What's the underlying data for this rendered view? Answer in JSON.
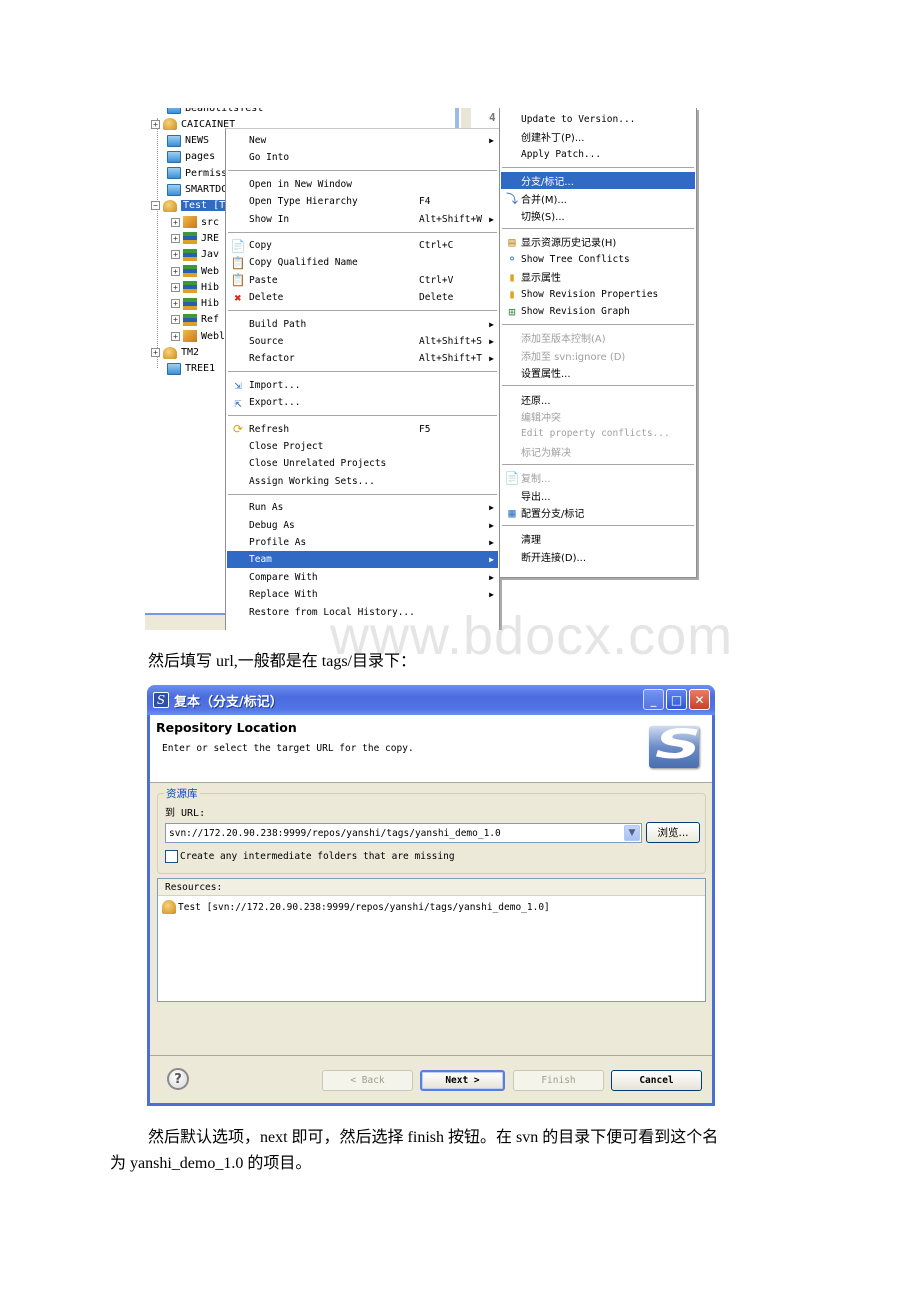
{
  "screenshot1": {
    "tree": {
      "items": [
        {
          "label": "BeanUtilsTest",
          "type": "folder",
          "expander": ""
        },
        {
          "label": "CAICAINET",
          "type": "project",
          "expander": "+"
        },
        {
          "label": "NEWS",
          "type": "folder",
          "expander": ""
        },
        {
          "label": "pages",
          "type": "folder",
          "expander": ""
        },
        {
          "label": "Permiss",
          "type": "folder",
          "expander": ""
        },
        {
          "label": "SMARTDC",
          "type": "folder",
          "expander": ""
        },
        {
          "label": "Test [T",
          "type": "project",
          "expander": "−",
          "selected": true
        },
        {
          "label": "src",
          "type": "pkg",
          "expander": "+"
        },
        {
          "label": "JRE",
          "type": "lib",
          "expander": "+"
        },
        {
          "label": "Jav",
          "type": "lib",
          "expander": "+"
        },
        {
          "label": "Web",
          "type": "lib",
          "expander": "+"
        },
        {
          "label": "Hib",
          "type": "lib",
          "expander": "+"
        },
        {
          "label": "Hib",
          "type": "lib",
          "expander": "+"
        },
        {
          "label": "Ref",
          "type": "lib",
          "expander": "+"
        },
        {
          "label": "Webl",
          "type": "pkg",
          "expander": "+"
        },
        {
          "label": "TM2",
          "type": "project",
          "expander": "+"
        },
        {
          "label": "TREE1",
          "type": "folder",
          "expander": ""
        }
      ]
    },
    "editor_tab_number": "4",
    "context_menu": {
      "items": [
        {
          "label": "New",
          "accel": "",
          "submenu": true,
          "icon": ""
        },
        {
          "label": "Go Into",
          "accel": "",
          "submenu": false,
          "icon": ""
        },
        {
          "separator": true
        },
        {
          "label": "Open in New Window",
          "accel": "",
          "submenu": false,
          "icon": ""
        },
        {
          "label": "Open Type Hierarchy",
          "accel": "F4",
          "submenu": false,
          "icon": ""
        },
        {
          "label": "Show In",
          "accel": "Alt+Shift+W",
          "submenu": true,
          "icon": ""
        },
        {
          "separator": true
        },
        {
          "label": "Copy",
          "accel": "Ctrl+C",
          "submenu": false,
          "icon": "copy-icon"
        },
        {
          "label": "Copy Qualified Name",
          "accel": "",
          "submenu": false,
          "icon": "copy-qualified-icon"
        },
        {
          "label": "Paste",
          "accel": "Ctrl+V",
          "submenu": false,
          "icon": "paste-icon"
        },
        {
          "label": "Delete",
          "accel": "Delete",
          "submenu": false,
          "icon": "delete-icon"
        },
        {
          "separator": true
        },
        {
          "label": "Build Path",
          "accel": "",
          "submenu": true,
          "icon": ""
        },
        {
          "label": "Source",
          "accel": "Alt+Shift+S",
          "submenu": true,
          "icon": ""
        },
        {
          "label": "Refactor",
          "accel": "Alt+Shift+T",
          "submenu": true,
          "icon": ""
        },
        {
          "separator": true
        },
        {
          "label": "Import...",
          "accel": "",
          "submenu": false,
          "icon": "import-icon"
        },
        {
          "label": "Export...",
          "accel": "",
          "submenu": false,
          "icon": "export-icon"
        },
        {
          "separator": true
        },
        {
          "label": "Refresh",
          "accel": "F5",
          "submenu": false,
          "icon": "refresh-icon"
        },
        {
          "label": "Close Project",
          "accel": "",
          "submenu": false,
          "icon": ""
        },
        {
          "label": "Close Unrelated Projects",
          "accel": "",
          "submenu": false,
          "icon": ""
        },
        {
          "label": "Assign Working Sets...",
          "accel": "",
          "submenu": false,
          "icon": ""
        },
        {
          "separator": true
        },
        {
          "label": "Run As",
          "accel": "",
          "submenu": true,
          "icon": ""
        },
        {
          "label": "Debug As",
          "accel": "",
          "submenu": true,
          "icon": ""
        },
        {
          "label": "Profile As",
          "accel": "",
          "submenu": true,
          "icon": ""
        },
        {
          "label": "Team",
          "accel": "",
          "submenu": true,
          "icon": "",
          "highlighted": true
        },
        {
          "label": "Compare With",
          "accel": "",
          "submenu": true,
          "icon": ""
        },
        {
          "label": "Replace With",
          "accel": "",
          "submenu": true,
          "icon": ""
        },
        {
          "label": "Restore from Local History...",
          "accel": "",
          "submenu": false,
          "icon": ""
        }
      ]
    },
    "team_menu": {
      "items": [
        {
          "label": "Update to Version...",
          "icon": ""
        },
        {
          "label": "创建补丁(P)...",
          "icon": ""
        },
        {
          "label": "Apply Patch...",
          "icon": ""
        },
        {
          "separator": true
        },
        {
          "label": "分支/标记...",
          "icon": "",
          "highlighted": true
        },
        {
          "label": "合并(M)...",
          "icon": "merge-icon"
        },
        {
          "label": "切换(S)...",
          "icon": ""
        },
        {
          "separator": true
        },
        {
          "label": "显示资源历史记录(H)",
          "icon": "history-icon"
        },
        {
          "label": "Show Tree Conflicts",
          "icon": "tree-conflicts-icon"
        },
        {
          "label": "显示属性",
          "icon": "properties-icon"
        },
        {
          "label": "Show Revision Properties",
          "icon": "revision-properties-icon"
        },
        {
          "label": "Show Revision Graph",
          "icon": "revision-graph-icon"
        },
        {
          "separator": true
        },
        {
          "label": "添加至版本控制(A)",
          "icon": "",
          "disabled": true
        },
        {
          "label": "添加至 svn:ignore (D)",
          "icon": "",
          "disabled": true
        },
        {
          "label": "设置属性...",
          "icon": ""
        },
        {
          "separator": true
        },
        {
          "label": "还原...",
          "icon": ""
        },
        {
          "label": "编辑冲突",
          "icon": "",
          "disabled": true
        },
        {
          "label": "Edit property conflicts...",
          "icon": "",
          "disabled": true
        },
        {
          "label": "标记为解决",
          "icon": "",
          "disabled": true
        },
        {
          "separator": true
        },
        {
          "label": "复制...",
          "icon": "copy-icon",
          "disabled": true
        },
        {
          "label": "导出...",
          "icon": ""
        },
        {
          "label": "配置分支/标记",
          "icon": "configure-branches-icon"
        },
        {
          "separator": true
        },
        {
          "label": "清理",
          "icon": ""
        },
        {
          "label": "断开连接(D)...",
          "icon": ""
        }
      ]
    }
  },
  "captions": {
    "caption1": "然后填写 url,一般都是在 tags/目录下：",
    "caption2": "然后默认选项，next 即可，然后选择 finish 按钮。在 svn 的目录下便可看到这个名",
    "caption3": "为 yanshi_demo_1.0 的项目。"
  },
  "watermark": "www.bdocx.com",
  "dialog": {
    "title": "复本（分支/标记）",
    "header_title": "Repository Location",
    "header_desc": "Enter or select the target URL for the copy.",
    "repo_group_label": "资源库",
    "url_label": "到 URL:",
    "url_value": "svn://172.20.90.238:9999/repos/yanshi/tags/yanshi_demo_1.0",
    "browse_label": "浏览...",
    "create_folders_label": "Create any intermediate folders that are missing",
    "create_folders_checked": false,
    "resources_header": "Resources:",
    "resources": [
      {
        "label": "Test [svn://172.20.90.238:9999/repos/yanshi/tags/yanshi_demo_1.0]"
      }
    ],
    "buttons": {
      "back": "< Back",
      "next": "Next >",
      "finish": "Finish",
      "cancel": "Cancel"
    },
    "colors": {
      "titlebar": "#4a6cdd",
      "highlight": "#316ac5",
      "group_label": "#0046d5"
    }
  }
}
